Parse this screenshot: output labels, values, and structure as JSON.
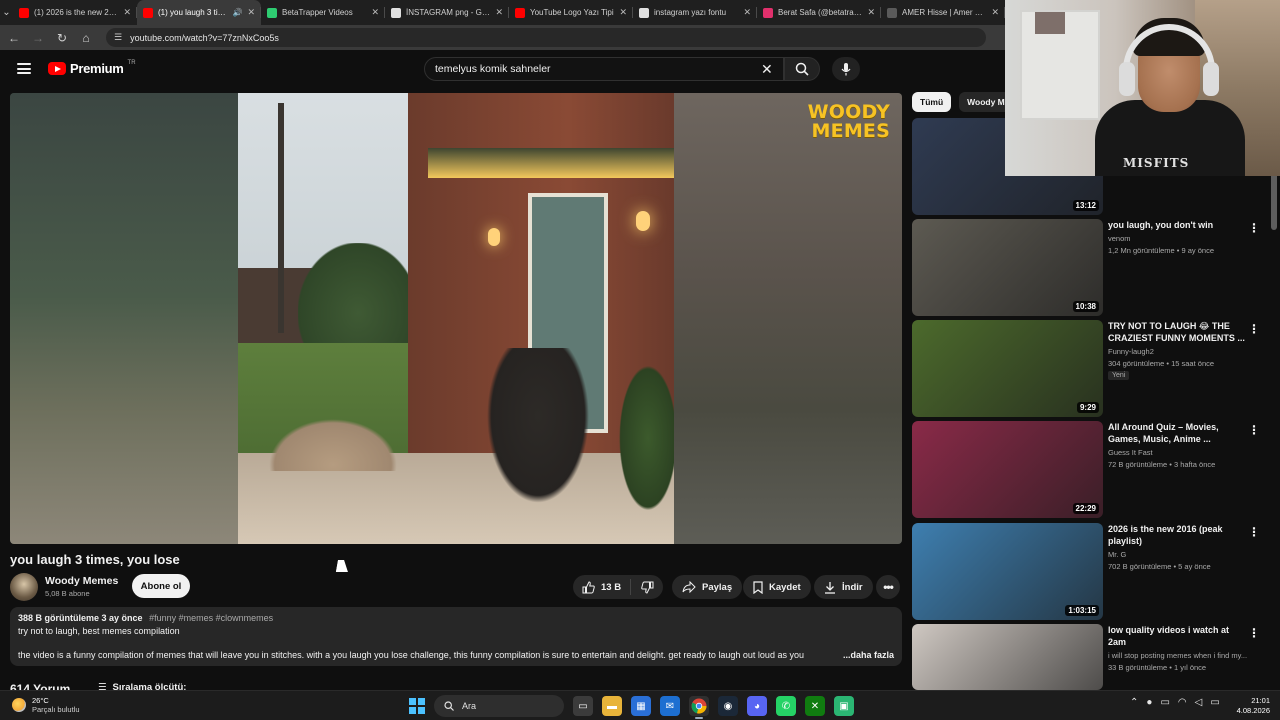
{
  "browser": {
    "tabs": [
      {
        "label": "(1) 2026 is the new 2016",
        "color": "#ff0000",
        "active": false
      },
      {
        "label": "(1) you laugh 3 times, you lose",
        "color": "#ff0000",
        "active": true
      },
      {
        "label": "BetaTrapper Videos",
        "color": "#2ecc71",
        "active": false
      },
      {
        "label": "İNSTAGRAM png - Google",
        "color": "#e0e0e0",
        "active": false
      },
      {
        "label": "YouTube Logo Yazı Tipi",
        "color": "#ff0000",
        "active": false
      },
      {
        "label": "instagram yazı fontu",
        "color": "#e0e0e0",
        "active": false
      },
      {
        "label": "Berat Safa (@betatrapper)",
        "color": "#e1306c",
        "active": false
      },
      {
        "label": "AMER Hisse | Amer Geliş",
        "color": "#5a5a5a",
        "active": false
      }
    ],
    "url": "youtube.com/watch?v=77znNxCoo5s"
  },
  "masthead": {
    "logo_text": "Premium",
    "logo_region": "TR",
    "search_query": "temelyus komik sahneler"
  },
  "player": {
    "watermark_line1": "WOODY",
    "watermark_line2": "MEMES"
  },
  "video": {
    "title": "you laugh 3 times, you lose",
    "channel": "Woody Memes",
    "subscribers": "5,08 B abone",
    "subscribe_label": "Abone ol",
    "likes": "13 B",
    "share_label": "Paylaş",
    "save_label": "Kaydet",
    "download_label": "İndir"
  },
  "description": {
    "views_date": "388 B görüntüleme  3 ay önce",
    "tags": "#funny #memes #clownmemes",
    "line1": "try not to laugh, best memes compilation",
    "line2": "the video is a funny compilation of memes that will leave you in stitches. with a you laugh you lose challenge, this funny compilation is sure to entertain and delight. get ready to laugh out loud as you",
    "more": "...daha fazla"
  },
  "comments": {
    "count": "614 Yorum",
    "sort_label": "Sıralama ölçütü:"
  },
  "sidebar": {
    "chips": [
      "Tümü",
      "Woody M"
    ],
    "recommendations": [
      {
        "title": "",
        "channel": "",
        "meta": "",
        "duration": "13:12",
        "thumb": "#2f3b52",
        "badge": ""
      },
      {
        "title": "you laugh, you don't win",
        "channel": "venom",
        "meta": "1,2 Mn görüntüleme • 9 ay önce",
        "duration": "10:38",
        "thumb": "#5d5a52",
        "badge": ""
      },
      {
        "title": "TRY NOT TO LAUGH 😂 THE CRAZIEST FUNNY MOMENTS ...",
        "channel": "Funny-laugh2",
        "meta": "304 görüntüleme • 15 saat önce",
        "duration": "9:29",
        "thumb": "#4c6a2c",
        "badge": "Yeni"
      },
      {
        "title": "All Around Quiz – Movies, Games, Music, Anime ...",
        "channel": "Guess It Fast",
        "meta": "72 B görüntüleme • 3 hafta önce",
        "duration": "22:29",
        "thumb": "#8a2a48",
        "badge": ""
      },
      {
        "title": "2026 is the new 2016 (peak playlist)",
        "channel": "Mr. G",
        "meta": "702 B görüntüleme • 5 ay önce",
        "duration": "1:03:15",
        "thumb": "#3e7fb0",
        "badge": ""
      },
      {
        "title": "low quality videos i watch at 2am",
        "channel": "i will stop posting memes when i find my...",
        "meta": "33 B görüntüleme • 1 yıl önce",
        "duration": "",
        "thumb": "#cfc8c2",
        "badge": ""
      }
    ]
  },
  "webcam": {
    "shirt_text": "MISFITS"
  },
  "taskbar": {
    "temperature": "26°C",
    "weather": "Parçalı bulutlu",
    "search_placeholder": "Ara",
    "time": "21:01",
    "date": "4.08.2026"
  }
}
